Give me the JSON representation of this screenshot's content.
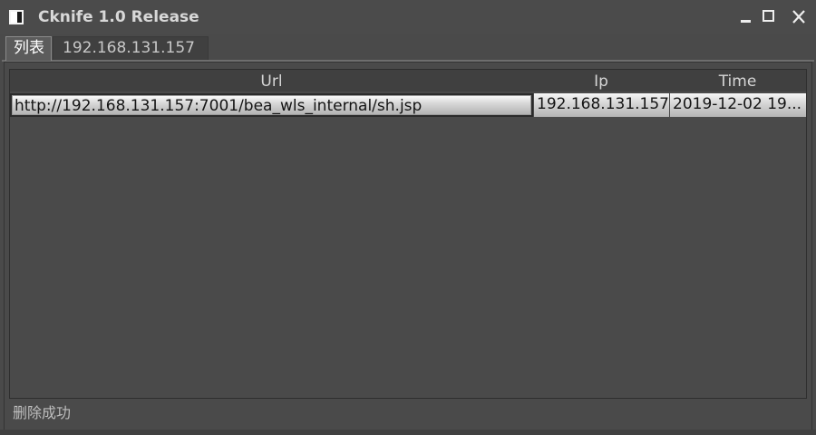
{
  "window": {
    "title": "Cknife 1.0 Release",
    "controls": {
      "minimize": "minimize-icon",
      "maximize": "maximize-icon",
      "close": "close-icon"
    }
  },
  "tabs": [
    {
      "label": "列表",
      "active": true
    },
    {
      "label": "192.168.131.157",
      "active": false
    }
  ],
  "table": {
    "columns": [
      "Url",
      "Ip",
      "Time"
    ],
    "rows": [
      {
        "url": "http://192.168.131.157:7001/bea_wls_internal/sh.jsp",
        "ip": "192.168.131.157",
        "time": "2019-12-02 19..."
      }
    ]
  },
  "status": {
    "text": "删除成功"
  },
  "colors": {
    "background": "#4a4a4a",
    "header_bg": "#404040",
    "title_text": "#d8d8d8",
    "row_selected": "#d4d4d4"
  }
}
